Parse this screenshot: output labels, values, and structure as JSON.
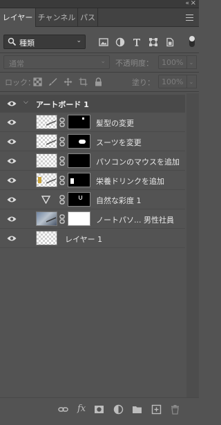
{
  "panel": {
    "collapse_glyph": "«",
    "close_glyph": "×"
  },
  "tabs": [
    {
      "label": "レイヤー",
      "active": true
    },
    {
      "label": "チャンネル",
      "active": false
    },
    {
      "label": "パス",
      "active": false
    }
  ],
  "filter": {
    "kind_label": "種類",
    "icons": [
      "image-filter-icon",
      "adjustment-filter-icon",
      "type-filter-icon",
      "shape-filter-icon",
      "smart-object-filter-icon"
    ]
  },
  "blend": {
    "mode": "通常",
    "opacity_label": "不透明度：",
    "opacity_value": "100%"
  },
  "lock": {
    "label": "ロック：",
    "fill_label": "塗り：",
    "fill_value": "100%"
  },
  "layers": {
    "group": {
      "name": "アートボード 1",
      "expanded": true
    },
    "rows": [
      {
        "name": "髪型の変更",
        "thumb": "transparent",
        "mask": "black"
      },
      {
        "name": "スーツを変更",
        "thumb": "transparent",
        "mask": "black"
      },
      {
        "name": "パソコンのマウスを追加",
        "thumb": "transparent",
        "mask": "black"
      },
      {
        "name": "栄養ドリンクを追加",
        "thumb": "transparent",
        "mask": "black"
      },
      {
        "name": "自然な彩度 1",
        "thumb": "adjustment",
        "mask": "black"
      },
      {
        "name": "ノートパソ... 男性社員",
        "thumb": "photo",
        "mask": "white"
      },
      {
        "name": "レイヤー 1",
        "thumb": "transparent",
        "mask": "none"
      }
    ]
  },
  "bottom_toolbar": {
    "fx_label": "fx",
    "icons": [
      "link-layers-icon",
      "layer-style-icon",
      "add-mask-icon",
      "new-adjustment-icon",
      "new-group-icon",
      "new-layer-icon",
      "delete-icon"
    ]
  },
  "colors": {
    "panel_bg": "#535353",
    "tab_bg": "#424242",
    "row_bg": "#535353",
    "group_bg": "#494949"
  }
}
